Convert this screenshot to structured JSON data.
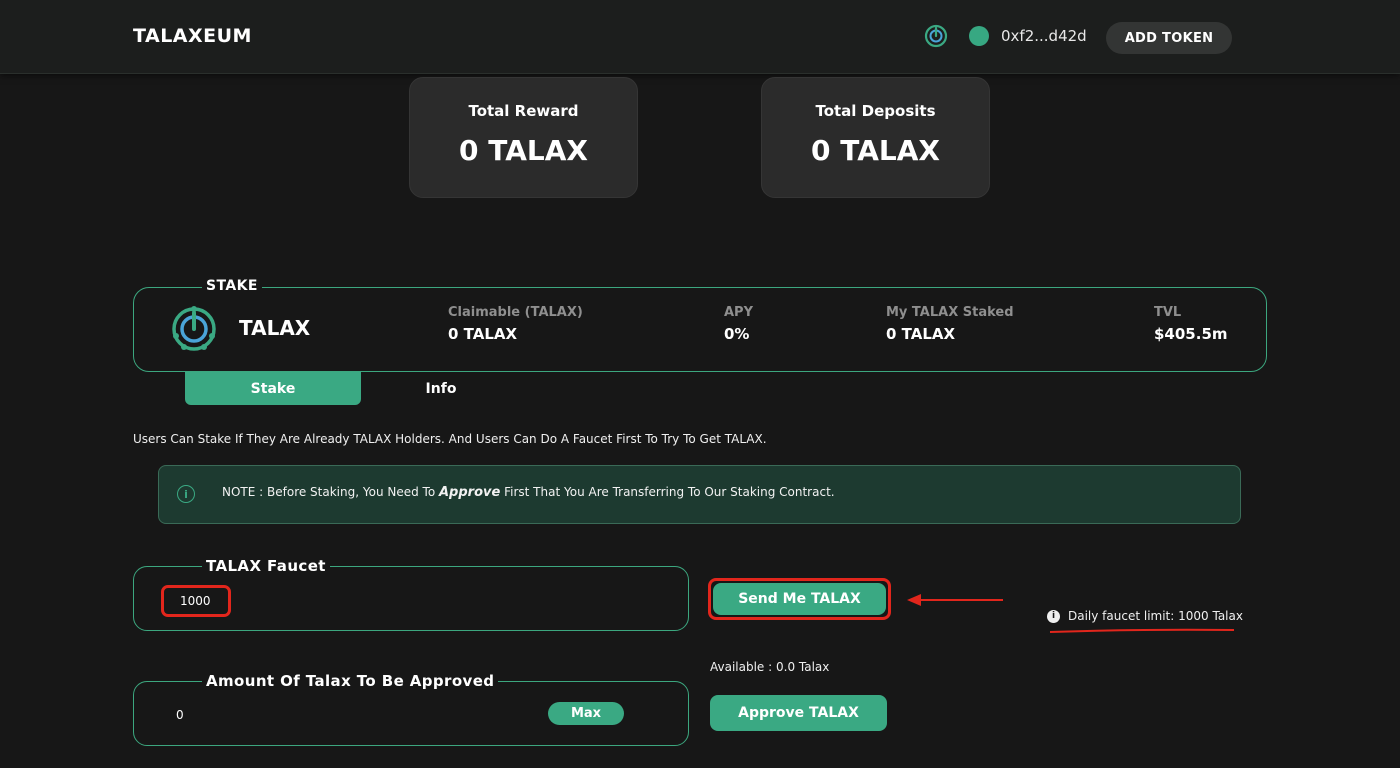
{
  "header": {
    "brand": "TALAXEUM",
    "wallet_address": "0xf2...d42d",
    "add_token_label": "ADD TOKEN"
  },
  "stats": {
    "total_reward_label": "Total Reward",
    "total_reward_value": "0 TALAX",
    "total_deposits_label": "Total Deposits",
    "total_deposits_value": "0 TALAX"
  },
  "stake_panel": {
    "legend": "STAKE",
    "token_name": "TALAX",
    "metrics": [
      {
        "label": "Claimable (TALAX)",
        "value": "0 TALAX"
      },
      {
        "label": "APY",
        "value": "0%"
      },
      {
        "label": "My TALAX Staked",
        "value": "0 TALAX"
      },
      {
        "label": "TVL",
        "value": "$405.5m"
      }
    ]
  },
  "tabs": {
    "stake": "Stake",
    "info": "Info"
  },
  "description": "Users Can Stake If They Are Already TALAX Holders. And Users Can Do A Faucet First To Try To Get TALAX.",
  "note": {
    "prefix": "NOTE : Before Staking, You Need To ",
    "emphasis": "Approve",
    "suffix": " First That You Are Transferring To Our Staking Contract."
  },
  "faucet": {
    "legend": "TALAX Faucet",
    "value": "1000",
    "button_label": "Send Me TALAX",
    "limit_text": "Daily faucet limit: 1000 Talax"
  },
  "approve": {
    "legend": "Amount Of Talax To Be Approved",
    "value": "0",
    "max_label": "Max",
    "available_text": "Available : 0.0 Talax",
    "button_label": "Approve TALAX"
  },
  "colors": {
    "background": "#171717",
    "accent": "#3aa983",
    "highlight": "#e2261c",
    "card": "#2b2b2b",
    "note_bg": "#1d3a30"
  },
  "icons": [
    "talax-logo-icon",
    "status-dot-icon",
    "info-icon",
    "arrow-left-icon"
  ]
}
